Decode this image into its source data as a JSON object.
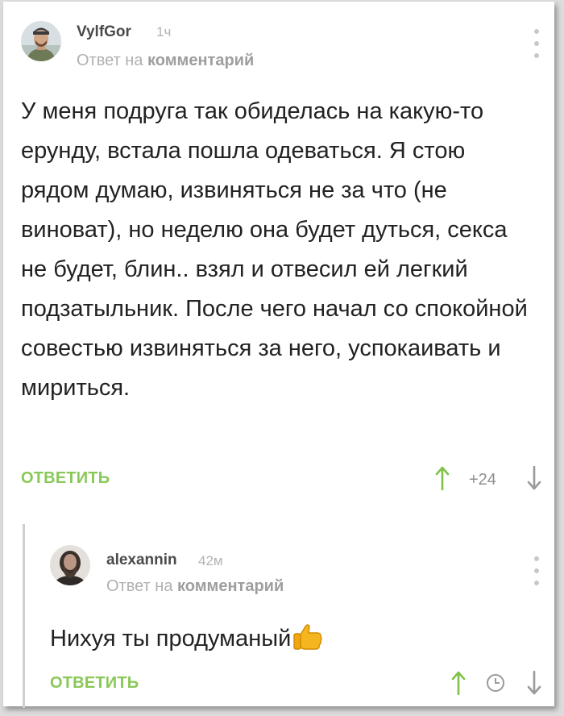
{
  "comment": {
    "username": "VylfGor",
    "time": "1ч",
    "reply_to_prefix": "Ответ на",
    "reply_to_target": "комментарий",
    "text": "У меня подруга так обиделась на какую-то ерунду, встала пошла одеваться. Я стою рядом думаю, извиняться не за что (не виноват), но неделю она будет дуться, секса не будет, блин.. взял и отвесил ей легкий подзатыльник. После чего начал со спокойной совестью извиняться за него, успокаивать и мириться.",
    "reply_label": "ОТВЕТИТЬ",
    "rating": "+24",
    "vote_up_icon": "arrow-up-icon",
    "vote_down_icon": "arrow-down-icon"
  },
  "reply": {
    "username": "alexannin",
    "time": "42м",
    "reply_to_prefix": "Ответ на",
    "reply_to_target": "комментарий",
    "text": "Нихуя ты продуманый",
    "emoji": "thumbs-up-icon",
    "reply_label": "ОТВЕТИТЬ",
    "vote_up_icon": "arrow-up-icon",
    "rating_hidden_icon": "clock-icon",
    "vote_down_icon": "arrow-down-icon"
  },
  "colors": {
    "accent_green": "#8ac858",
    "up_arrow": "#7fc14a",
    "muted_gray": "#b0b0b0",
    "body_text": "#222222"
  }
}
